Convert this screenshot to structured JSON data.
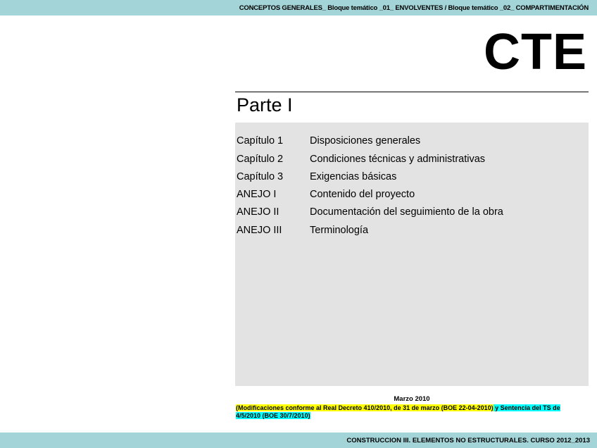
{
  "header": {
    "text": "CONCEPTOS GENERALES_ Bloque temático _01_ ENVOLVENTES / Bloque temático _02_ COMPARTIMENTACIÓN"
  },
  "document": {
    "title": "CTE",
    "part_title": "Parte I",
    "toc": [
      {
        "label": "Capítulo 1",
        "text": "Disposiciones generales"
      },
      {
        "label": "Capítulo 2",
        "text": "Condiciones técnicas y administrativas"
      },
      {
        "label": "Capítulo 3",
        "text": "Exigencias básicas"
      },
      {
        "label": "ANEJO I",
        "text": "Contenido del proyecto"
      },
      {
        "label": "ANEJO II",
        "text": "Documentación del seguimiento de la obra"
      },
      {
        "label": "ANEJO III",
        "text": "Terminología"
      }
    ],
    "date": "Marzo 2010",
    "note_part1": "(Modificaciones conforme al Real Decreto 410/2010, de 31 de marzo (BOE 22-04-2010)",
    "note_part2": " y Sentencia del TS de 4/5/2010 (BOE 30/7/2010)"
  },
  "footer": {
    "text": "CONSTRUCCION III. ELEMENTOS NO ESTRUCTURALES. CURSO 2012_2013"
  },
  "colors": {
    "bar": "#a3d4d8",
    "toc_background": "#e3e3e3",
    "highlight_yellow": "#ffff00",
    "highlight_cyan": "#00ffff"
  }
}
